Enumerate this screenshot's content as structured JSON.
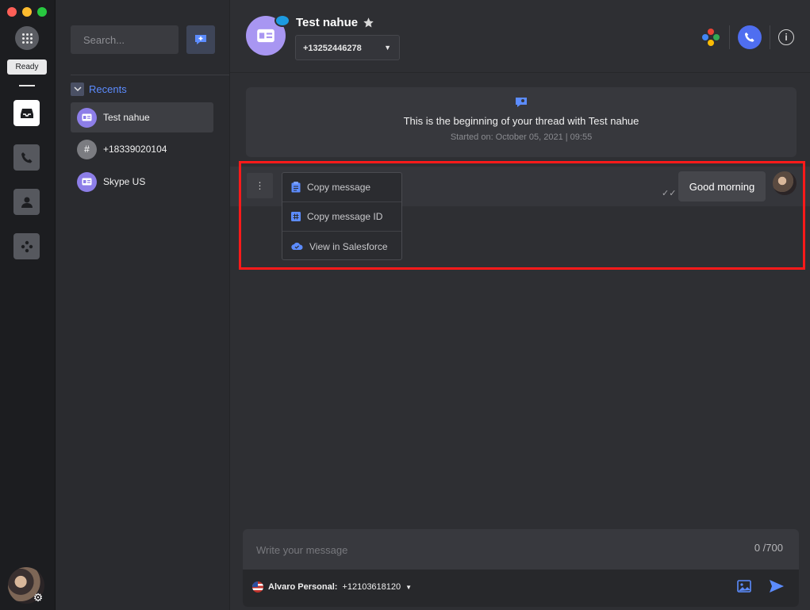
{
  "rail": {
    "status": "Ready",
    "colors": {
      "close": "#fe5f57",
      "minimize": "#febc2e",
      "maximize": "#28c840"
    },
    "items": [
      {
        "icon": "inbox-icon",
        "active": true
      },
      {
        "icon": "phone-icon",
        "active": false
      },
      {
        "icon": "contact-icon",
        "active": false
      },
      {
        "icon": "apps-icon",
        "active": false
      }
    ]
  },
  "contacts": {
    "search_placeholder": "Search...",
    "section_label": "Recents",
    "items": [
      {
        "name": "Test nahue",
        "avatar": "id-card-icon",
        "active": true
      },
      {
        "name": "+18339020104",
        "avatar": "#",
        "active": false
      },
      {
        "name": "Skype US",
        "avatar": "id-card-icon",
        "active": false
      }
    ]
  },
  "header": {
    "name": "Test nahue",
    "number": "+13252446278"
  },
  "thread": {
    "intro": "This is the beginning of your thread with Test nahue",
    "started": "Started on: October 05, 2021 | 09:55"
  },
  "message": {
    "text": "Good morning"
  },
  "context_menu": {
    "items": [
      {
        "label": "Copy message",
        "icon": "clipboard-icon"
      },
      {
        "label": "Copy message ID",
        "icon": "hash-icon"
      },
      {
        "label": "View in Salesforce",
        "icon": "cloud-icon"
      }
    ]
  },
  "composer": {
    "placeholder": "Write your message",
    "count": "0 /700",
    "from_label": "Alvaro Personal:",
    "from_number": "+12103618120"
  },
  "colors": {
    "accent": "#4f6ef0",
    "avatar_purple": "#8d7ee8",
    "highlight": "#ff1a1a"
  }
}
